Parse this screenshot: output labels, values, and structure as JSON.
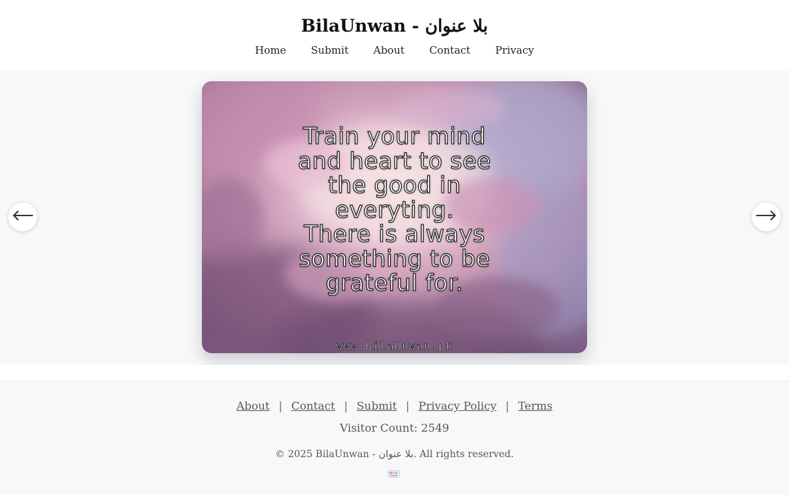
{
  "header": {
    "title": "BilaUnwan - بلا عنوان",
    "nav": [
      "Home",
      "Submit",
      "About",
      "Contact",
      "Privacy"
    ]
  },
  "carousel": {
    "quote_lines": [
      "Train your mind",
      "and heart to see",
      "the good in",
      "everyting.",
      "There is always",
      "something to be",
      "grateful for."
    ],
    "watermark": "www.BilaUnwan.pk",
    "prev_icon": "arrow-left-icon",
    "next_icon": "arrow-right-icon",
    "image_colors": {
      "sky_light": "#e9c8d8",
      "sky_mid": "#c38fae",
      "sky_dark": "#6d5070",
      "sky_blue": "#a8a8cc"
    }
  },
  "footer": {
    "links": {
      "about": "About",
      "contact": "Contact",
      "submit": "Submit",
      "privacy": "Privacy Policy",
      "terms": "Terms"
    },
    "separator": "|",
    "visitor_count": "Visitor Count: 2549",
    "copyright": "© 2025 BilaUnwan - بلا عنوان. All rights reserved."
  }
}
